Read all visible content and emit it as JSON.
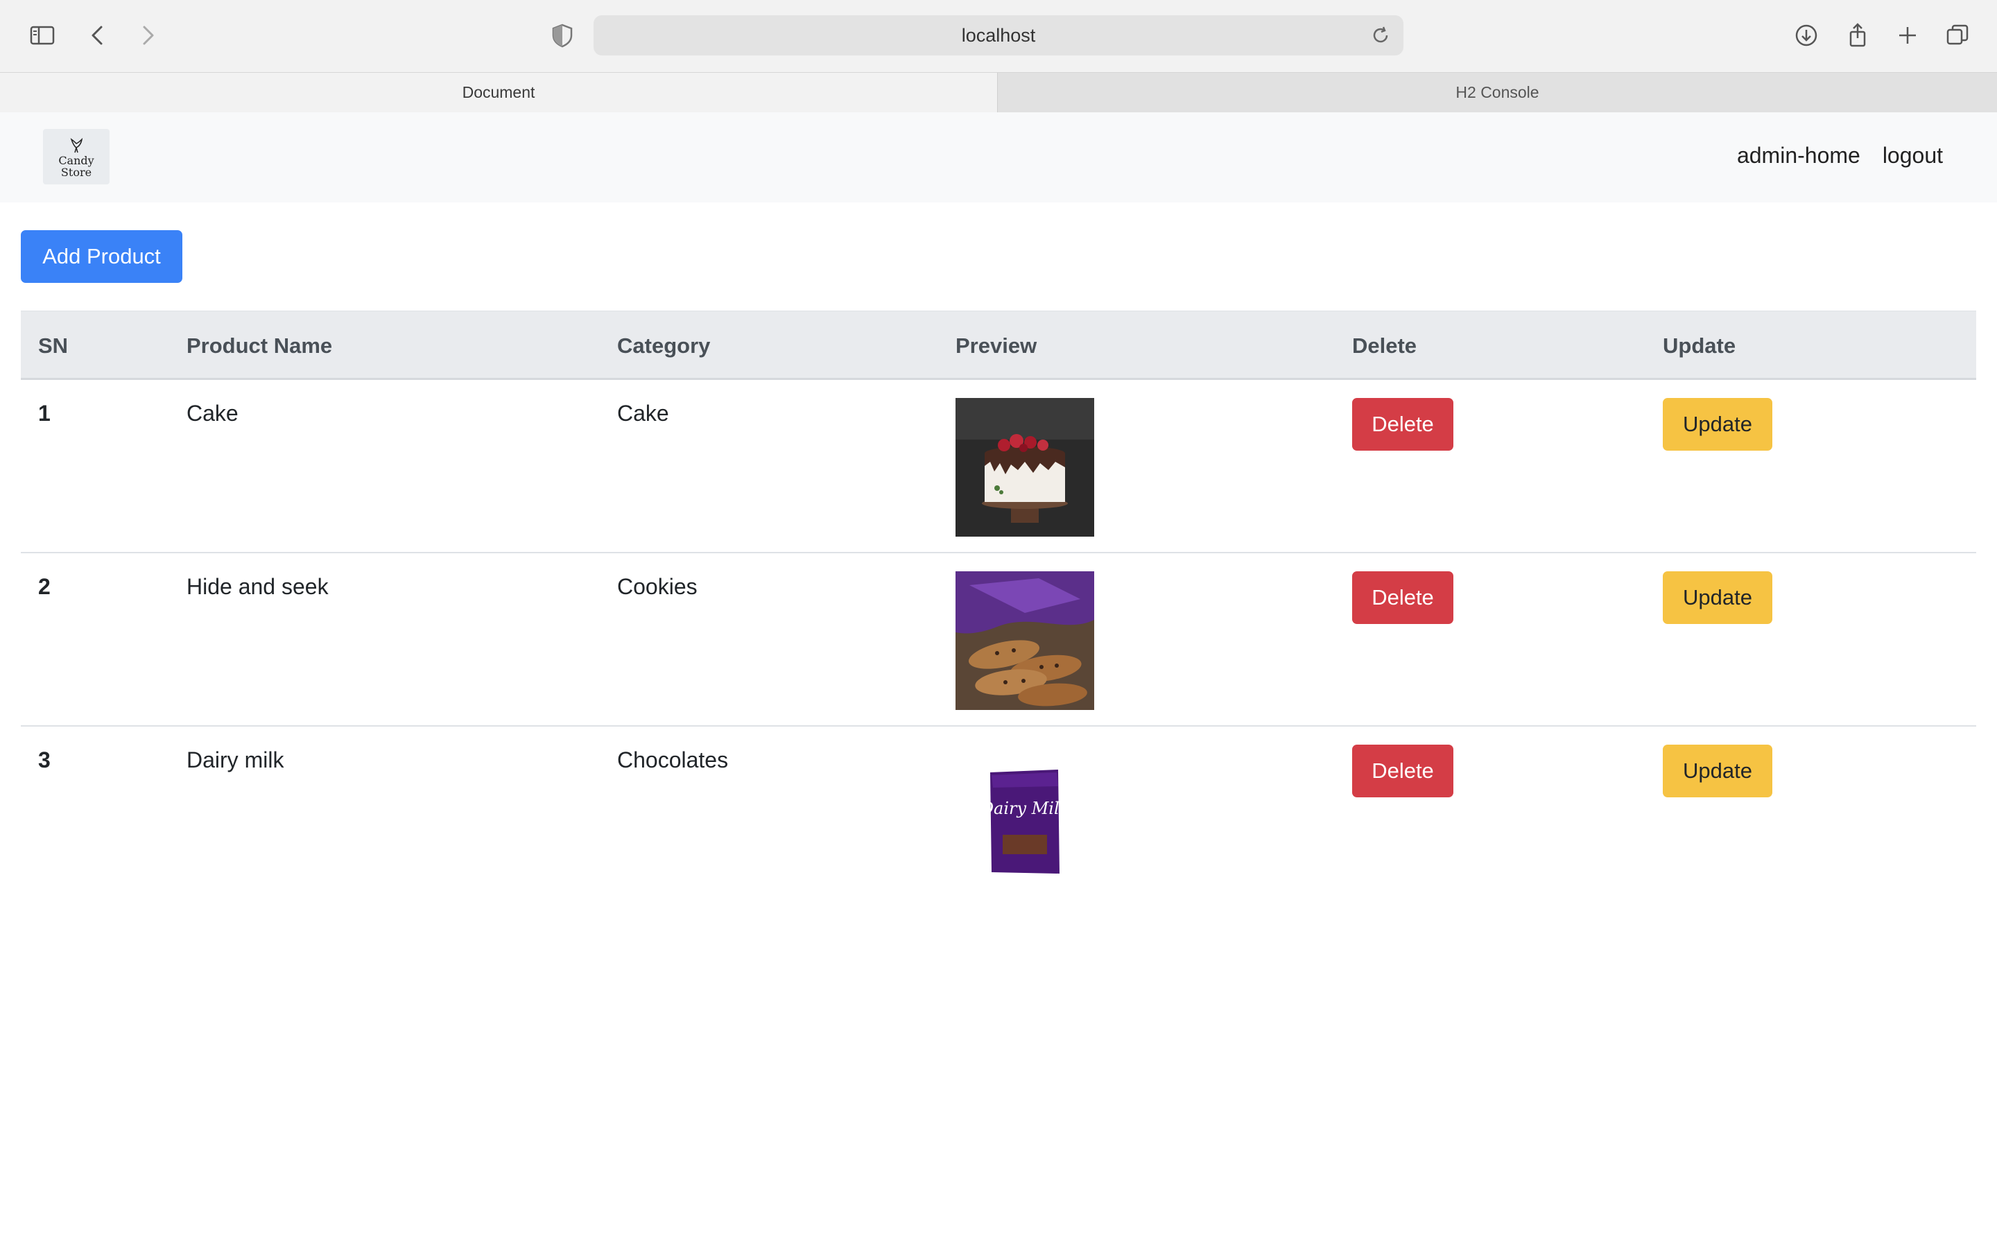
{
  "browser": {
    "url": "localhost",
    "tabs": [
      {
        "label": "Document",
        "active": true
      },
      {
        "label": "H2 Console",
        "active": false
      }
    ]
  },
  "navbar": {
    "logo_text": [
      "Candy",
      "Store"
    ],
    "links": [
      "admin-home",
      "logout"
    ]
  },
  "add_button": "Add Product",
  "table": {
    "headers": [
      "SN",
      "Product Name",
      "Category",
      "Preview",
      "Delete",
      "Update"
    ],
    "rows": [
      {
        "sn": "1",
        "name": "Cake",
        "category": "Cake",
        "preview": "cake-image",
        "delete": "Delete",
        "update": "Update"
      },
      {
        "sn": "2",
        "name": "Hide and seek",
        "category": "Cookies",
        "preview": "cookies-image",
        "delete": "Delete",
        "update": "Update"
      },
      {
        "sn": "3",
        "name": "Dairy milk",
        "category": "Chocolates",
        "preview": "chocolate-image",
        "delete": "Delete",
        "update": "Update"
      }
    ]
  },
  "product_image_text": {
    "chocolate_brand": "Dairy Milk"
  },
  "colors": {
    "primary": "#3a82f7",
    "danger": "#d43d46",
    "warning": "#f6c343"
  }
}
